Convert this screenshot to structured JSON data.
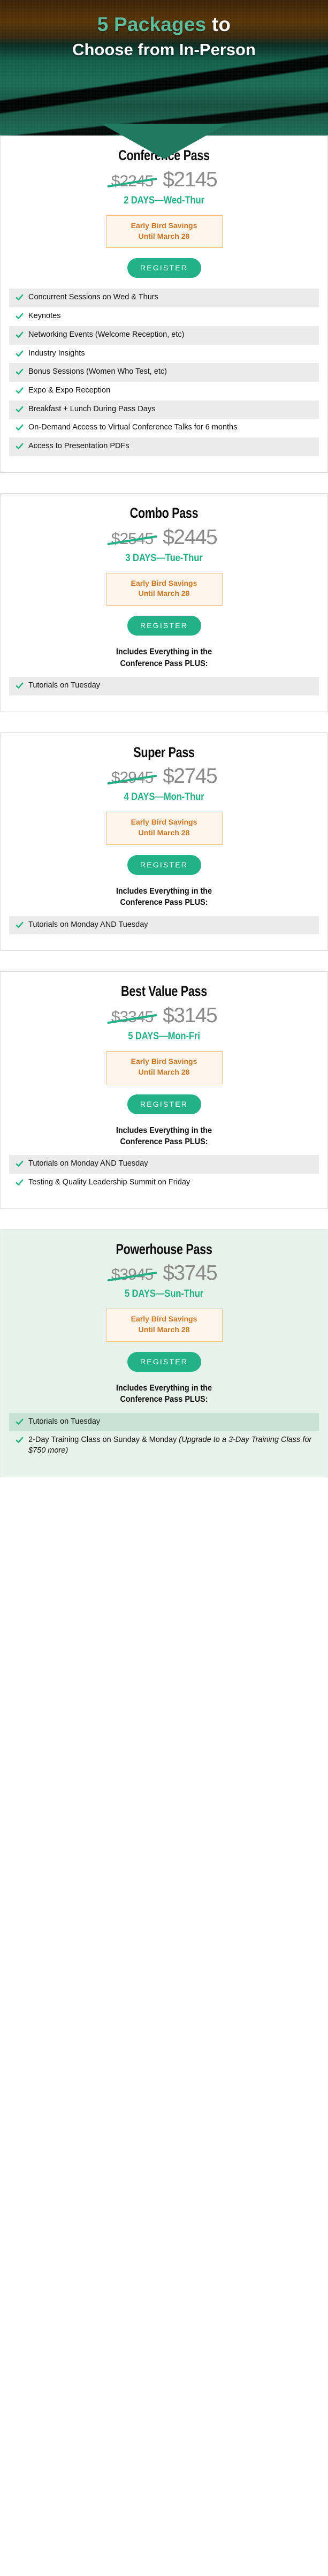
{
  "header": {
    "line1_accent": "5 Packages",
    "line1_rest": " to",
    "line2": "Choose from In-Person",
    "accent_color": "#5cbd9c"
  },
  "colors": {
    "brand_green": "#21b184",
    "price_gray": "#8a8a8a",
    "earlybird_text": "#c9741f",
    "earlybird_bg": "#fdf5ec",
    "earlybird_border": "#f0c183",
    "row_stripe": "#ebebeb",
    "highlight_card_bg": "#e7f2ec",
    "highlight_row_stripe": "#c9e2d6"
  },
  "common": {
    "early_bird_line1": "Early Bird Savings",
    "early_bird_line2": "Until March 28",
    "register_label": "REGISTER",
    "includes_prefix": "Includes Everything in the",
    "includes_strong": "Conference Pass",
    "includes_suffix": " PLUS:"
  },
  "packages": [
    {
      "title": "Conference Pass",
      "price_old": "$2245",
      "price_new": "$2145",
      "days": "2 DAYS—Wed-Thur",
      "early_bird_line1": "Early Bird Savings",
      "early_bird_line2": "Until March 28",
      "register_label": "REGISTER",
      "includes_note": null,
      "features": [
        "Concurrent Sessions on Wed & Thurs",
        "Keynotes",
        "Networking Events (Welcome Reception, etc)",
        "Industry Insights",
        "Bonus Sessions (Women Who Test, etc)",
        "Expo & Expo Reception",
        "Breakfast + Lunch During Pass Days",
        "On-Demand Access to Virtual Conference Talks for 6 months",
        "Access to Presentation PDFs"
      ]
    },
    {
      "title": "Combo Pass",
      "price_old": "$2545",
      "price_new": "$2445",
      "days": "3 DAYS—Tue-Thur",
      "early_bird_line1": "Early Bird Savings",
      "early_bird_line2": "Until March 28",
      "register_label": "REGISTER",
      "includes_note": "Includes Everything in the Conference Pass  PLUS:",
      "features": [
        "Tutorials on Tuesday"
      ]
    },
    {
      "title": "Super Pass",
      "price_old": "$2945",
      "price_new": "$2745",
      "days": "4 DAYS—Mon-Thur",
      "early_bird_line1": "Early Bird Savings",
      "early_bird_line2": "Until March 28",
      "register_label": "REGISTER",
      "includes_note": "Includes Everything in the Conference Pass  PLUS:",
      "features": [
        "Tutorials on Monday AND Tuesday"
      ]
    },
    {
      "title": "Best Value Pass",
      "price_old": "$3345",
      "price_new": "$3145",
      "days": "5 DAYS—Mon-Fri",
      "early_bird_line1": "Early Bird Savings",
      "early_bird_line2": "Until March 28",
      "register_label": "REGISTER",
      "includes_note": "Includes Everything in the Conference Pass PLUS:",
      "features": [
        "Tutorials on Monday AND Tuesday",
        "Testing & Quality Leadership Summit on Friday"
      ]
    },
    {
      "title": "Powerhouse Pass",
      "price_old": "$3945",
      "price_new": "$3745",
      "days": "5 DAYS—Sun-Thur",
      "early_bird_line1": "Early Bird Savings",
      "early_bird_line2": "Until March 28",
      "register_label": "REGISTER",
      "includes_note": "Includes Everything in the Conference Pass PLUS:",
      "highlight": true,
      "features": [
        "Tutorials on Tuesday",
        "2-Day Training Class on Sunday & Monday (Upgrade to a 3-Day Training Class for $750 more)"
      ],
      "features_italic_tail": [
        null,
        "(Upgrade to a 3-Day Training Class for $750 more)"
      ]
    }
  ]
}
